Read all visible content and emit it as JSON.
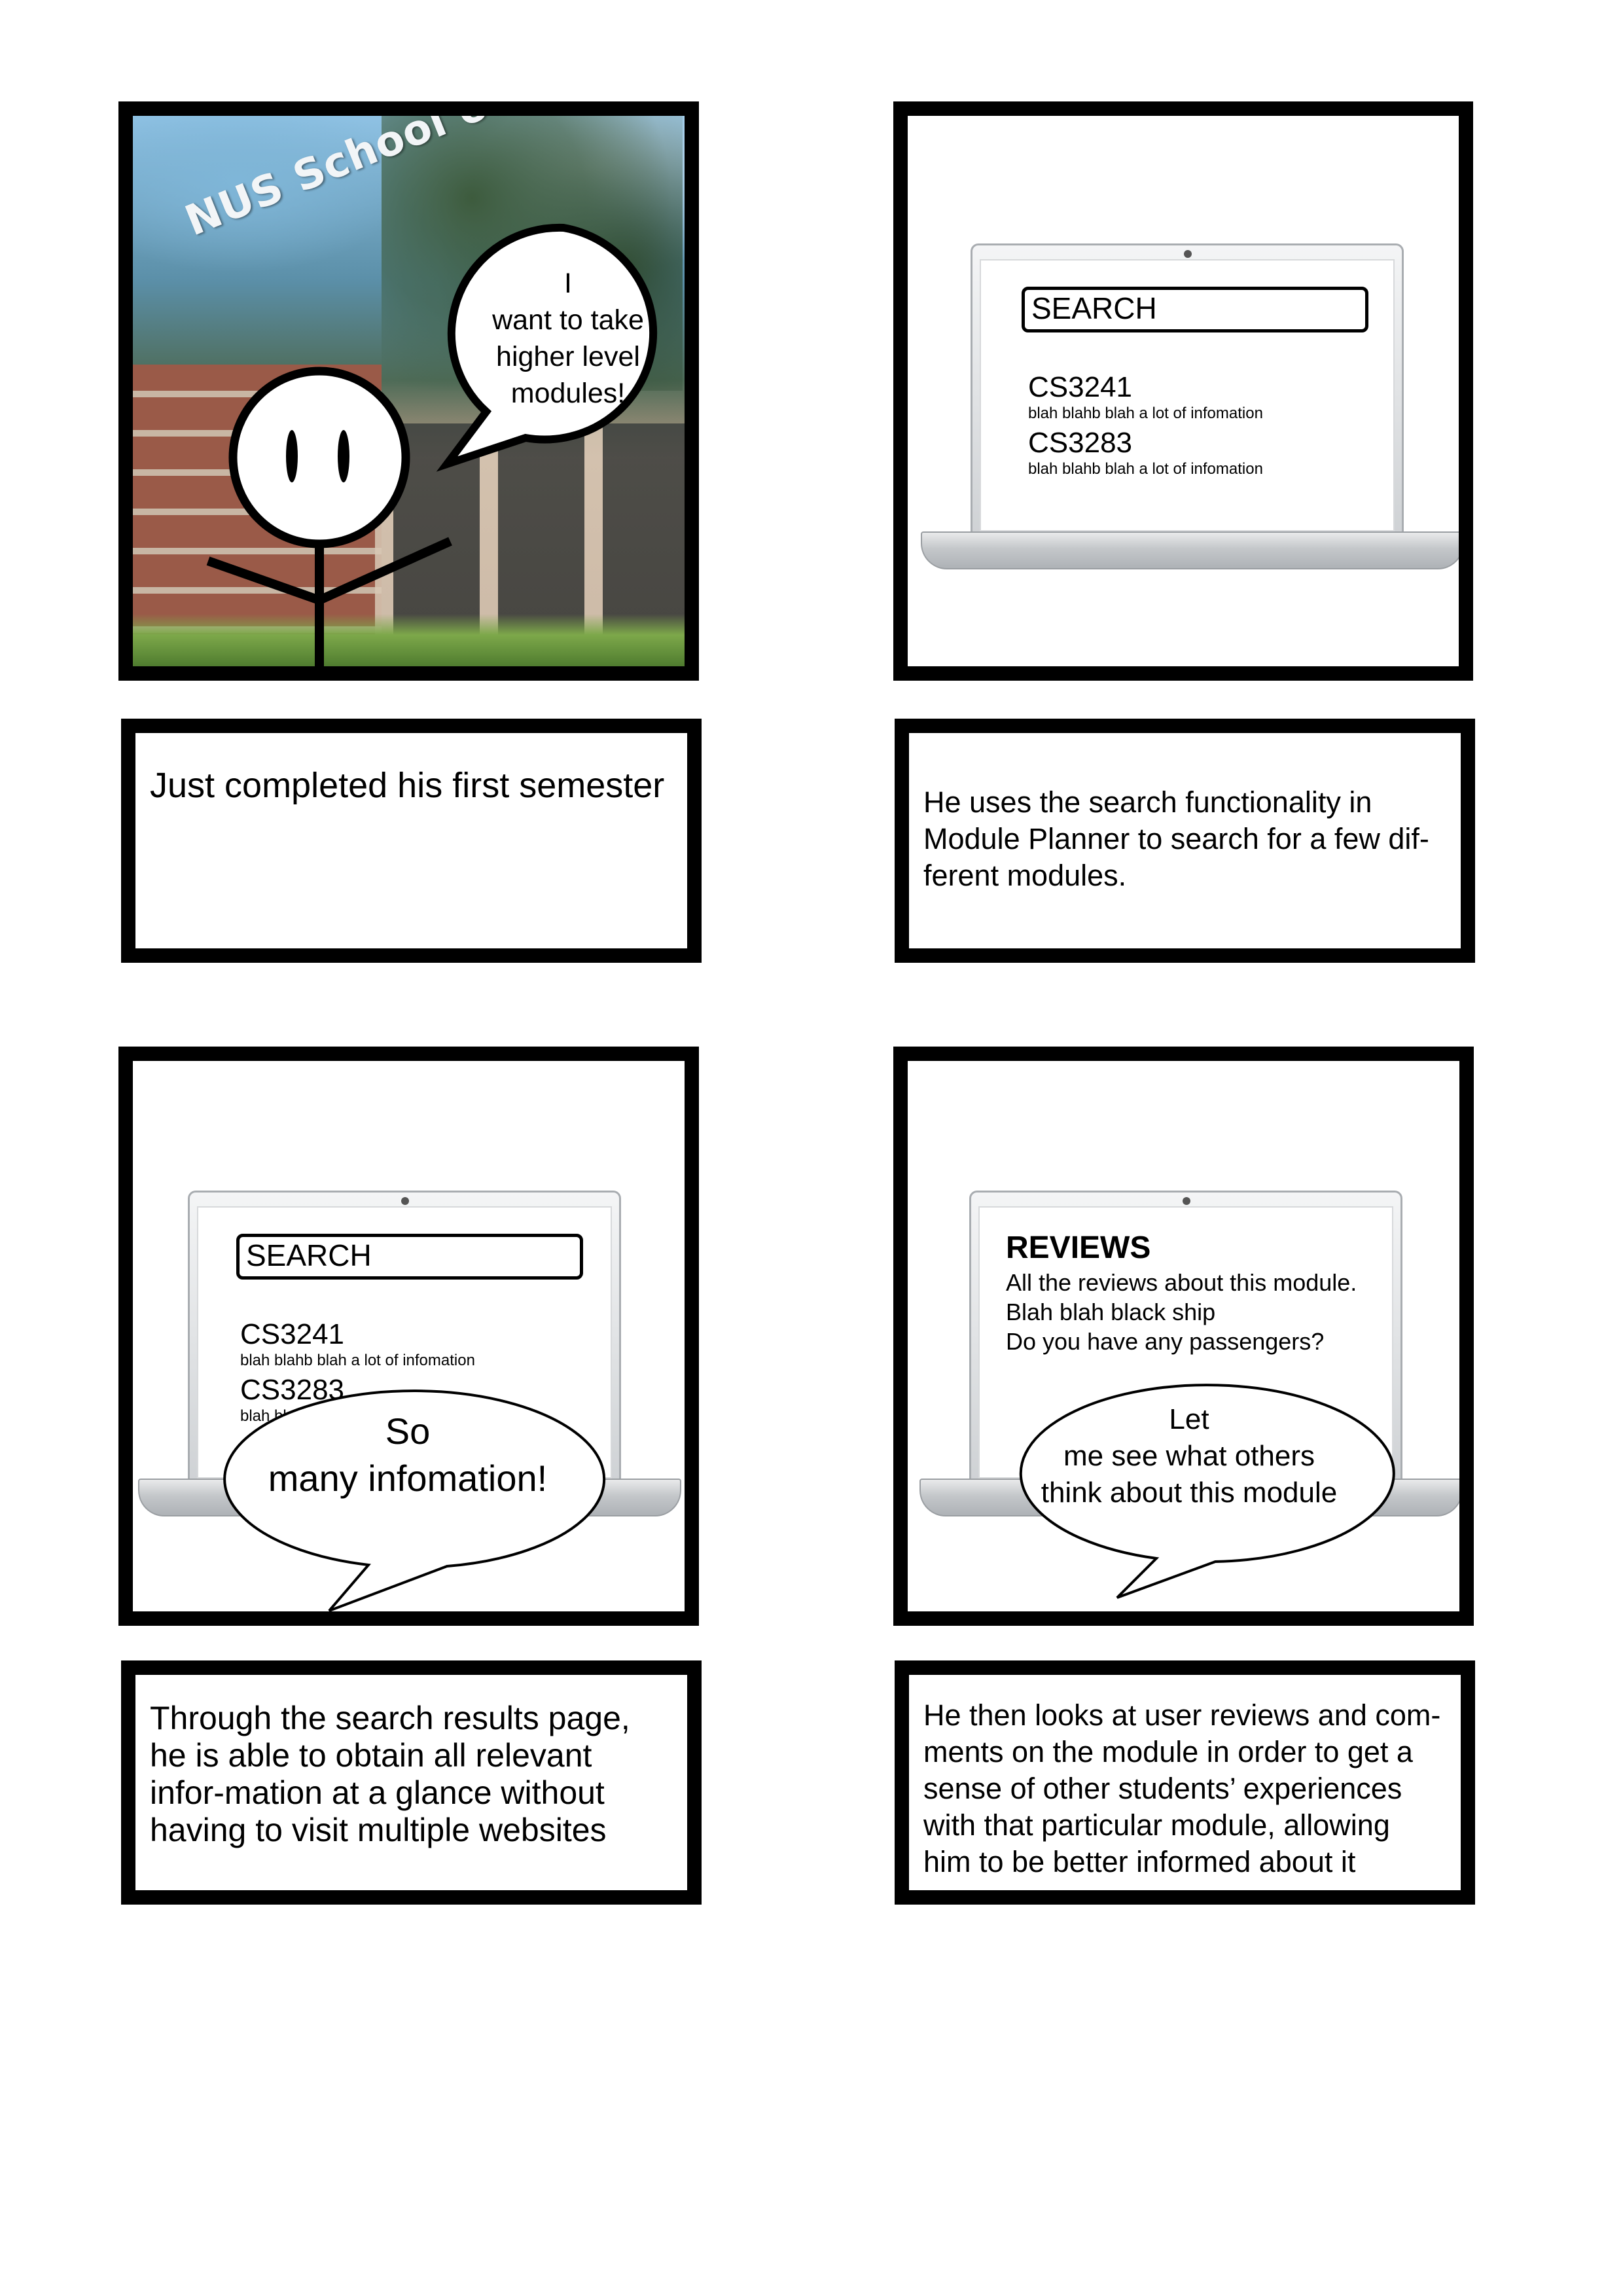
{
  "panel1": {
    "sign_text": "NUS School of Computing",
    "bubble_text": "I\nwant to take\nhigher level\nmodules!"
  },
  "panel2": {
    "search_label": "SEARCH",
    "results": [
      {
        "code": "CS3241",
        "info": "blah blahb blah a lot of infomation"
      },
      {
        "code": "CS3283",
        "info": "blah blahb blah a lot of infomation"
      }
    ]
  },
  "panel3": {
    "search_label": "SEARCH",
    "results": [
      {
        "code": "CS3241",
        "info": "blah blahb blah a lot of infomation"
      },
      {
        "code": "CS3283",
        "info": "blah blahb blah a lot of infomation"
      }
    ],
    "bubble_text": "So\nmany infomation!"
  },
  "panel4": {
    "title": "REVIEWS",
    "lines": [
      "All the reviews about this module.",
      "Blah blah black ship",
      "Do you have any passengers?"
    ],
    "bubble_text": "Let\nme see what others\nthink about this module"
  },
  "captions": {
    "c1": "Just completed his first semester",
    "c2": "He uses the search functionality in Module Planner to search for a few dif-ferent modules.",
    "c3": "Through the search results page, he is able to obtain all relevant infor-mation at a glance without having to visit multiple websites",
    "c4": "He then looks at user reviews and com-ments on the module in order to get a sense of other students’ experiences with that particular module, allowing him to be better informed about it"
  }
}
